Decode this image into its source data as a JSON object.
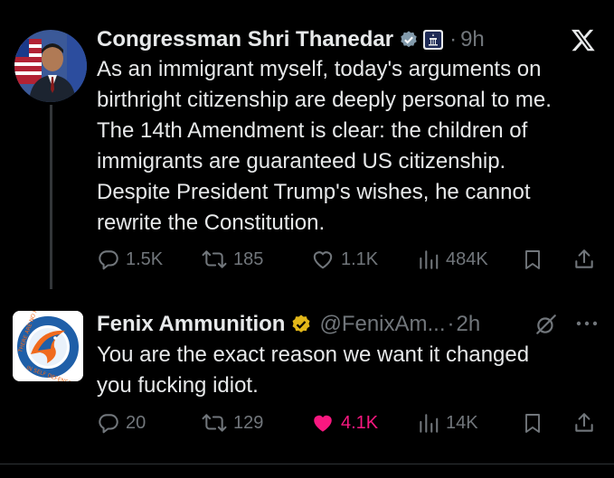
{
  "tweets": [
    {
      "author": "Congressman Shri Thanedar",
      "time": "9h",
      "dot": "·",
      "text_lines": [
        "As an immigrant myself, today's arguments on",
        "birthright citizenship are deeply personal to me.",
        "The 14th Amendment is clear: the children of",
        "immigrants are guaranteed US citizenship.",
        "Despite President Trump's wishes, he cannot",
        "rewrite the Constitution."
      ],
      "replies": "1.5K",
      "reposts": "185",
      "likes": "1.1K",
      "views": "484K",
      "icons": [
        "verified-badge-icon",
        "government-badge-icon",
        "x-logo-icon"
      ]
    },
    {
      "author": "Fenix Ammunition",
      "handle": "@FenixAm...",
      "time": "2h",
      "dot": "·",
      "text_lines": [
        "You are the exact reason we want it changed",
        "you fucking idiot."
      ],
      "replies": "20",
      "reposts": "129",
      "likes": "4.1K",
      "views": "14K",
      "liked": true,
      "avatar_text": [
        "THERE ARE NO RULES",
        "IN SELF DEFENSE"
      ],
      "icons": [
        "gold-verified-badge-icon",
        "grok-icon",
        "more-icon"
      ]
    }
  ],
  "colors": {
    "background": "#000000",
    "text": "#e7e9ea",
    "muted": "#71767b",
    "verified": "#1d9bf0",
    "like": "#f91880",
    "gold": "#e2b719"
  }
}
